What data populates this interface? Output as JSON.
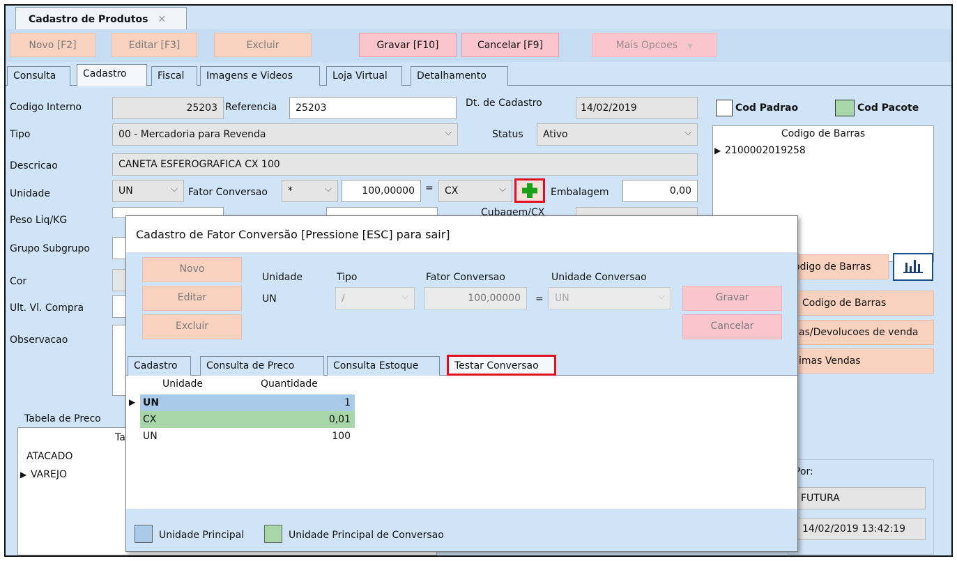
{
  "window": {
    "tab_title": "Cadastro de Produtos",
    "close_glyph": "✕"
  },
  "toolbar": {
    "novo": "Novo [F2]",
    "editar": "Editar [F3]",
    "excluir": "Excluir",
    "gravar": "Gravar [F10]",
    "cancelar": "Cancelar [F9]",
    "mais": "Mais Opcoes",
    "mais_arrow": "▼"
  },
  "tabs": [
    "Consulta",
    "Cadastro",
    "Fiscal",
    "Imagens e Videos",
    "Loja Virtual",
    "Detalhamento"
  ],
  "form": {
    "codigo_interno_label": "Codigo Interno",
    "codigo_interno_value": "25203",
    "referencia_label": "Referencia",
    "referencia_value": "25203",
    "dt_cadastro_label": "Dt. de Cadastro",
    "dt_cadastro_value": "14/02/2019",
    "tipo_label": "Tipo",
    "tipo_value": "00 - Mercadoria para Revenda",
    "status_label": "Status",
    "status_value": "Ativo",
    "descricao_label": "Descricao",
    "descricao_value": "CANETA ESFEROGRAFICA CX 100",
    "unidade_label": "Unidade",
    "unidade_value": "UN",
    "fator_label": "Fator Conversao",
    "fator_op": "*",
    "fator_value": "100,00000",
    "eq": "=",
    "conv_unit": "CX",
    "embalagem_label": "Embalagem",
    "embalagem_value": "0,00",
    "peso_label": "Peso Liq/KG",
    "cubagem_label": "Cubagem/CX",
    "grupo_label": "Grupo Subgrupo",
    "cor_label": "Cor",
    "ult_label": "Ult. Vl. Compra",
    "obs_label": "Observacao",
    "tabela_label": "Tabela de Preco",
    "tabela_col": "Ta",
    "tabela_rows": [
      "ATACADO",
      "VAREJO"
    ]
  },
  "barcode": {
    "padrao": "Cod Padrao",
    "pacote": "Cod Pacote",
    "header": "Codigo de Barras",
    "row": "2100002019258",
    "btn1": "odigo de Barras",
    "btn2": "Codigo de Barras",
    "btn3": "as/Devolucoes de venda",
    "btn4": "imas Vendas",
    "por_label": "Por:",
    "user": "FUTURA",
    "datetime": "14/02/2019 13:42:19"
  },
  "dialog": {
    "title": "Cadastro de Fator Conversão [Pressione [ESC] para sair]",
    "novo": "Novo",
    "editar": "Editar",
    "excluir": "Excluir",
    "unidade_label": "Unidade",
    "unidade_value": "UN",
    "tipo_label": "Tipo",
    "tipo_value": "/",
    "fator_label": "Fator Conversao",
    "fator_value": "100,00000",
    "eq": "=",
    "unidade_conv_label": "Unidade Conversao",
    "unidade_conv_value": "UN",
    "gravar": "Gravar",
    "cancelar": "Cancelar",
    "tabs": [
      "Cadastro",
      "Consulta de Preco",
      "Consulta Estoque",
      "Testar Conversao"
    ],
    "grid_headers": [
      "Unidade",
      "Quantidade"
    ],
    "grid_rows": [
      {
        "unidade": "UN",
        "quantidade": "1"
      },
      {
        "unidade": "CX",
        "quantidade": "0,01"
      },
      {
        "unidade": "UN",
        "quantidade": "100"
      }
    ],
    "legend_principal": "Unidade Principal",
    "legend_conversao": "Unidade Principal de Conversao"
  },
  "colors": {
    "accent_blue": "#a9cbe9",
    "accent_green": "#a7d6a8",
    "highlight_red": "#e01020",
    "button_salmon": "#f9d1bf",
    "button_pink": "#fbc5cd",
    "panel_blue": "#d0e4f7"
  }
}
